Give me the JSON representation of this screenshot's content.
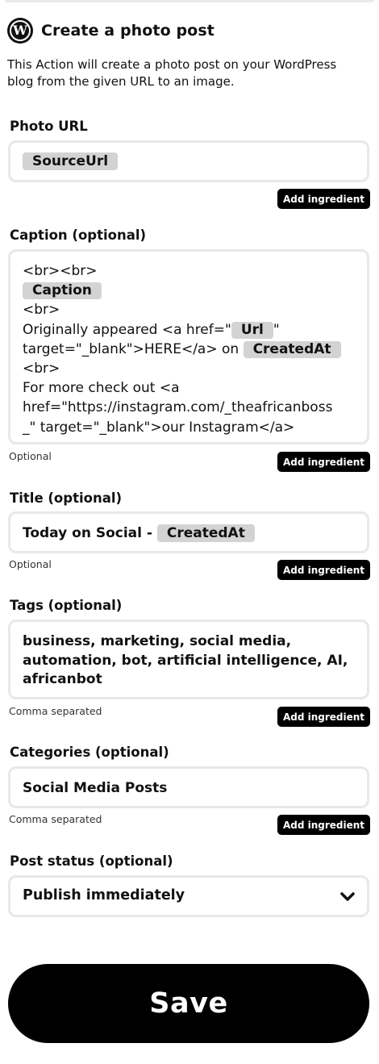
{
  "header": {
    "title": "Create a photo post",
    "icon": "wordpress-logo-icon"
  },
  "description": "This Action will create a photo post on your WordPress blog from the given URL to an image.",
  "fields": {
    "photo_url": {
      "label": "Photo URL",
      "ingredient": "SourceUrl",
      "button": "Add ingredient"
    },
    "caption": {
      "label": "Caption (optional)",
      "lines": {
        "l1": "<br><br>",
        "ing_caption": "Caption",
        "l3": "<br>",
        "l4a": "Originally appeared <a href=\"",
        "ing_url": "Url",
        "l4b": "\"",
        "l5a": "target=\"_blank\">HERE</a> on ",
        "ing_created": "CreatedAt",
        "l6": "<br>",
        "l7": "For more check out <a",
        "l8": "href=\"https://instagram.com/_theafricanboss",
        "l9": "_\" target=\"_blank\">our Instagram</a>"
      },
      "hint": "Optional",
      "button": "Add ingredient"
    },
    "title": {
      "label": "Title (optional)",
      "text": "Today on Social - ",
      "ingredient": "CreatedAt",
      "hint": "Optional",
      "button": "Add ingredient"
    },
    "tags": {
      "label": "Tags (optional)",
      "lines": [
        "business, marketing, social media,",
        "automation, bot, artificial intelligence, AI,",
        "africanbot"
      ],
      "hint": "Comma separated",
      "button": "Add ingredient"
    },
    "categories": {
      "label": "Categories (optional)",
      "value": "Social Media Posts",
      "hint": "Comma separated",
      "button": "Add ingredient"
    },
    "post_status": {
      "label": "Post status (optional)",
      "selected": "Publish immediately"
    }
  },
  "save_label": "Save"
}
